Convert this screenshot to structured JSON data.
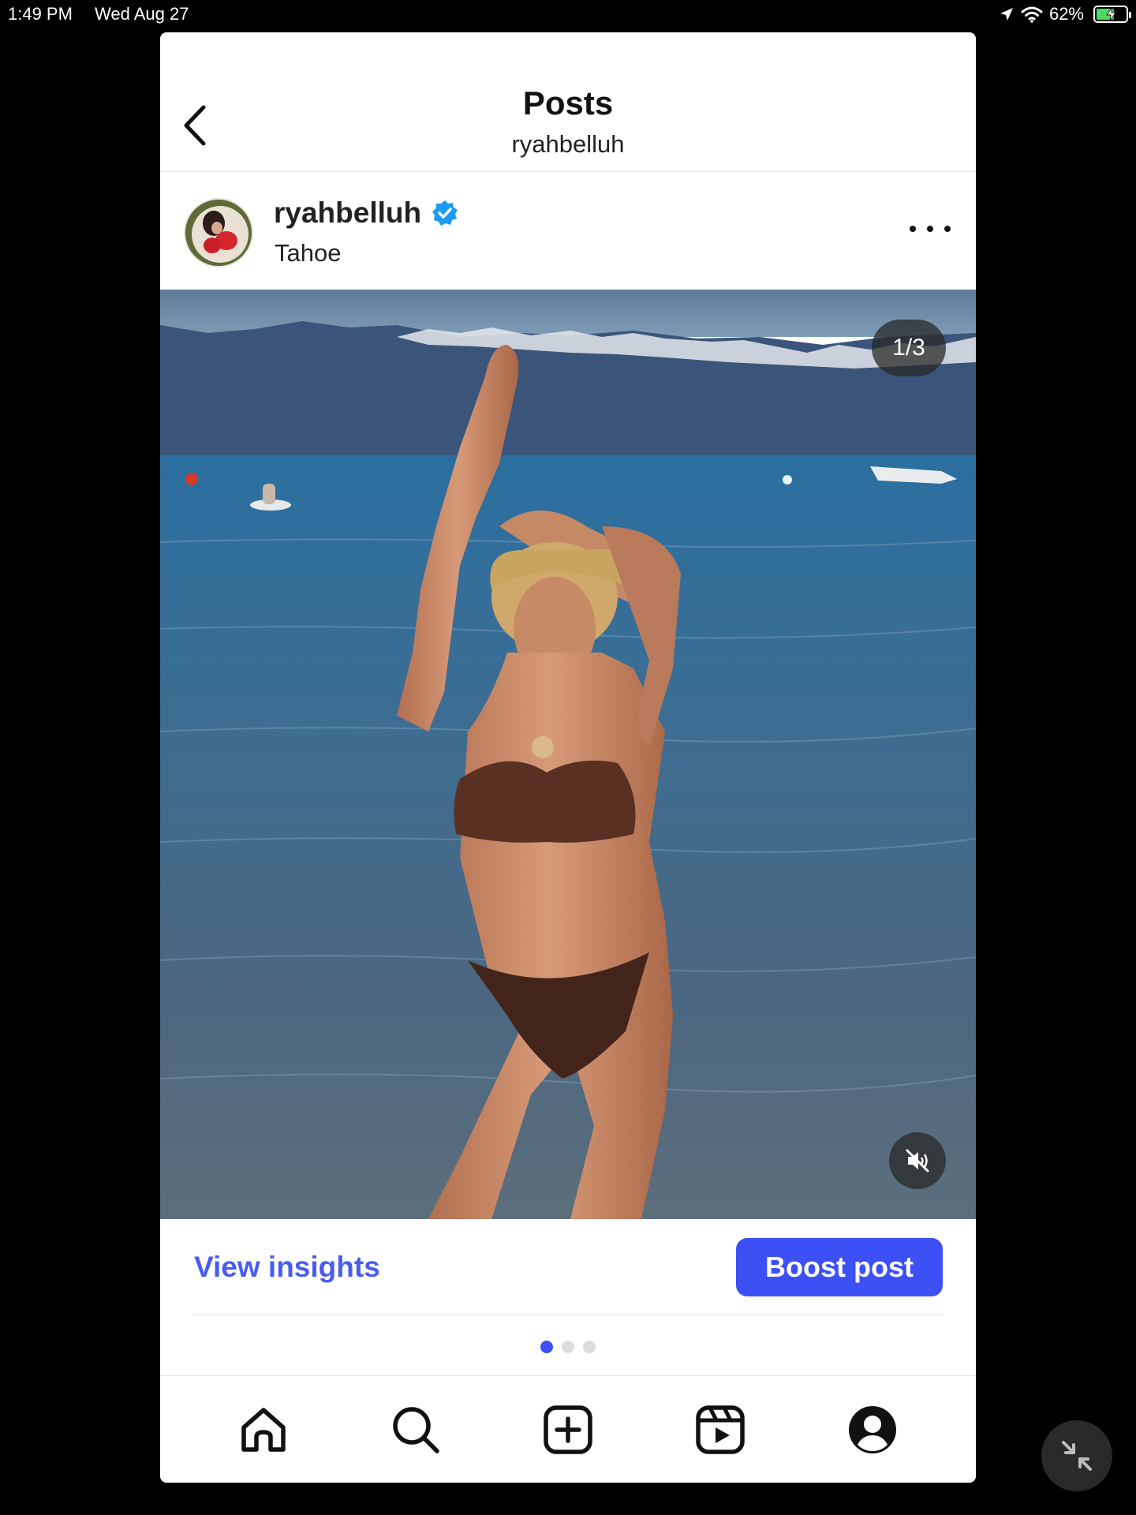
{
  "status_bar": {
    "time": "1:49 PM",
    "date": "Wed Aug 27",
    "battery": "62%",
    "battery_level": 0.62
  },
  "header": {
    "title": "Posts",
    "subtitle": "ryahbelluh"
  },
  "post": {
    "username": "ryahbelluh",
    "location": "Tahoe",
    "verified": true,
    "page_counter": "1/3",
    "current_page": 1,
    "total_pages": 3
  },
  "actions": {
    "view_insights": "View insights",
    "boost_post": "Boost post"
  },
  "tabs": [
    "home-icon",
    "search-icon",
    "create-icon",
    "reels-icon",
    "profile-icon"
  ],
  "colors": {
    "accent": "#3d50f5",
    "link": "#4a5cf0",
    "verified": "#1d9bf0"
  }
}
